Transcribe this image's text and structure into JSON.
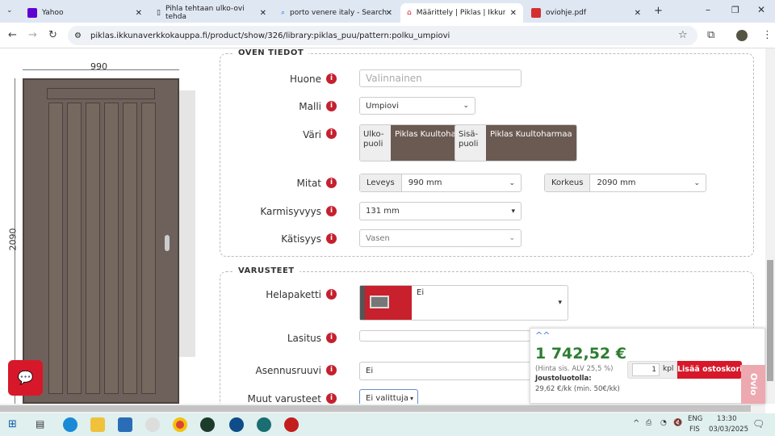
{
  "browser": {
    "tabs": [
      {
        "title": "Yahoo",
        "color": "#6001d2"
      },
      {
        "title": "Pihla tehtaan ulko-ovi tehda"
      },
      {
        "title": "porto venere italy - Search"
      },
      {
        "title": "Määrittely | Piklas | Ikkunat ja",
        "active": true
      },
      {
        "title": "oviohje.pdf",
        "color": "#d32f2f"
      }
    ],
    "url": "piklas.ikkunaverkkokauppa.fi/product/show/326/library:piklas_puu/pattern:polku_umpiovi"
  },
  "door": {
    "width": "990",
    "height": "2090"
  },
  "section1": {
    "title": "OVEN TIEDOT",
    "huone": {
      "label": "Huone",
      "placeholder": "Valinnainen"
    },
    "malli": {
      "label": "Malli",
      "value": "Umpiovi"
    },
    "vari": {
      "label": "Väri",
      "outside_label": "Ulko-puoli",
      "outside_value": "Piklas Kuultoharmaa",
      "inside_label": "Sisä-puoli",
      "inside_value": "Piklas Kuultoharmaa",
      "swatch": "#6b5a52"
    },
    "mitat": {
      "label": "Mitat",
      "width_label": "Leveys",
      "width_value": "990 mm",
      "height_label": "Korkeus",
      "height_value": "2090 mm"
    },
    "karmisyvyys": {
      "label": "Karmisyvyys",
      "value": "131 mm"
    },
    "katisyys": {
      "label": "Kätisyys",
      "value": "Vasen"
    }
  },
  "section2": {
    "title": "VARUSTEET",
    "helapaketti": {
      "label": "Helapaketti",
      "value": "Ei"
    },
    "lasitus": {
      "label": "Lasitus",
      "value": ""
    },
    "asennusruuvi": {
      "label": "Asennusruuvi",
      "value": "Ei"
    },
    "muut": {
      "label": "Muut varusteet",
      "value": "Ei valittuja"
    }
  },
  "price": {
    "total": "1 742,52 €",
    "vat_note": "(Hinta sis. ALV 25,5 %)",
    "financing_label": "Joustoluotolla:",
    "financing_value": "29,62 €/kk (min. 50€/kk)",
    "quantity": "1",
    "unit": "kpl",
    "add_to_cart": "Lisää ostoskoriin",
    "accent": "#d7182a",
    "price_color": "#2e7d32"
  },
  "side_tab": "Ovio",
  "taskbar": {
    "lang1": "ENG",
    "lang2": "FIS",
    "time": "13:30",
    "date": "03/03/2025"
  }
}
